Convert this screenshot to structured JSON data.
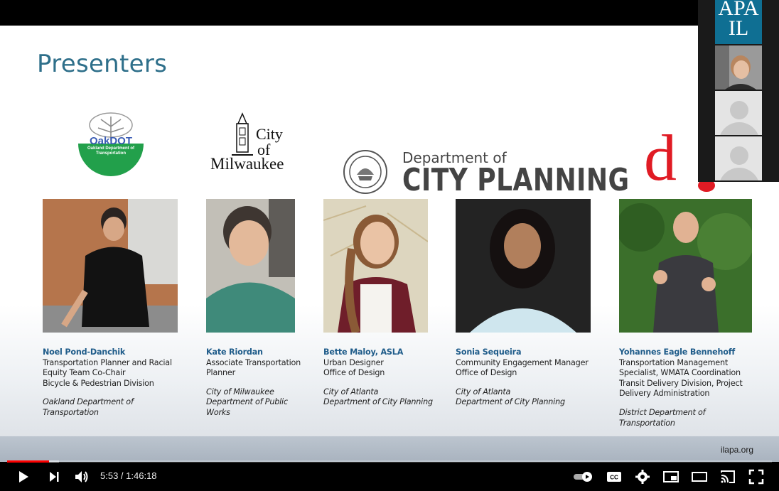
{
  "player": {
    "current_time": "5:53",
    "duration": "1:46:18",
    "progress_fraction": 0.055,
    "buffered_fraction": 0.068,
    "accent": "#ff0000"
  },
  "slide": {
    "title": "Presenters",
    "footer_url": "ilapa.org",
    "logos": {
      "oakdot_name": "OakDOT",
      "oakdot_sub": "Oakland Department of Transportation",
      "mke_city": "City",
      "mke_of": "of",
      "mke_name": "Milwaukee",
      "dcp_top": "Department of",
      "dcp_big": "CITY PLANNING",
      "ddot_letter": "d"
    },
    "presenters": [
      {
        "name": "Noel Pond-Danchik",
        "title_lines": [
          "Transportation Planner and Racial",
          "Equity Team Co-Chair",
          "Bicycle & Pedestrian Division"
        ],
        "org_lines": [
          "Oakland Department of",
          "Transportation"
        ]
      },
      {
        "name": "Kate Riordan",
        "title_lines": [
          "Associate Transportation",
          "Planner"
        ],
        "org_lines": [
          "City of Milwaukee",
          "Department of Public",
          "Works"
        ]
      },
      {
        "name": "Bette Maloy, ASLA",
        "title_lines": [
          "Urban Designer",
          "Office of Design"
        ],
        "org_lines": [
          "City of Atlanta",
          "Department of City Planning"
        ]
      },
      {
        "name": "Sonia Sequeira",
        "title_lines": [
          "Community Engagement Manager",
          "Office of Design"
        ],
        "org_lines": [
          "City of Atlanta",
          "Department of City Planning"
        ]
      },
      {
        "name": "Yohannes Eagle Bennehoff",
        "title_lines": [
          "Transportation Management",
          "Specialist, WMATA Coordination",
          "Transit Delivery Division, Project",
          "Delivery Administration"
        ],
        "org_lines": [
          "District Department of",
          "Transportation"
        ]
      }
    ]
  },
  "participants": {
    "apa_top": "APA",
    "apa_bottom": "IL",
    "brand_color": "#0f6f93"
  },
  "icons": {
    "play": "play-icon",
    "next": "next-icon",
    "volume": "volume-icon",
    "autoplay": "autoplay-toggle-icon",
    "captions": "captions-icon",
    "settings": "gear-icon",
    "miniplayer": "miniplayer-icon",
    "theater": "theater-icon",
    "cast": "cast-icon",
    "fullscreen": "fullscreen-icon"
  }
}
